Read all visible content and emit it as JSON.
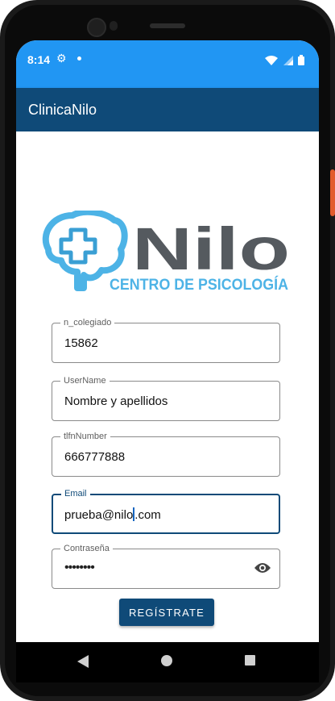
{
  "status_bar": {
    "time": "8:14",
    "icons": [
      "settings-gear-icon",
      "notification-dot-icon",
      "wifi-icon",
      "signal-icon",
      "battery-icon"
    ]
  },
  "app_bar": {
    "title": "ClinicaNilo"
  },
  "logo": {
    "brand": "Nilo",
    "tagline": "CENTRO DE PSICOLOGÍA",
    "colors": {
      "blue": "#4db3e6",
      "gray": "#555a5f"
    }
  },
  "form": {
    "n_colegiado": {
      "label": "n_colegiado",
      "value": "15862"
    },
    "username": {
      "label": "UserName",
      "value": "Nombre y apellidos"
    },
    "phone": {
      "label": "tlfnNumber",
      "value": "666777888"
    },
    "email": {
      "label": "Email",
      "value_before_cursor": "prueba@nilo",
      "value_after_cursor": ".com"
    },
    "password": {
      "label": "Contraseña",
      "value": "••••••••",
      "toggle_icon": "eye-icon"
    },
    "submit_label": "REGÍSTRATE"
  },
  "colors": {
    "status_bar": "#2196f3",
    "app_bar": "#0f4a78",
    "accent": "#0f4a78"
  },
  "nav_bar": {
    "icons": [
      "back-icon",
      "home-icon",
      "recents-icon"
    ]
  }
}
